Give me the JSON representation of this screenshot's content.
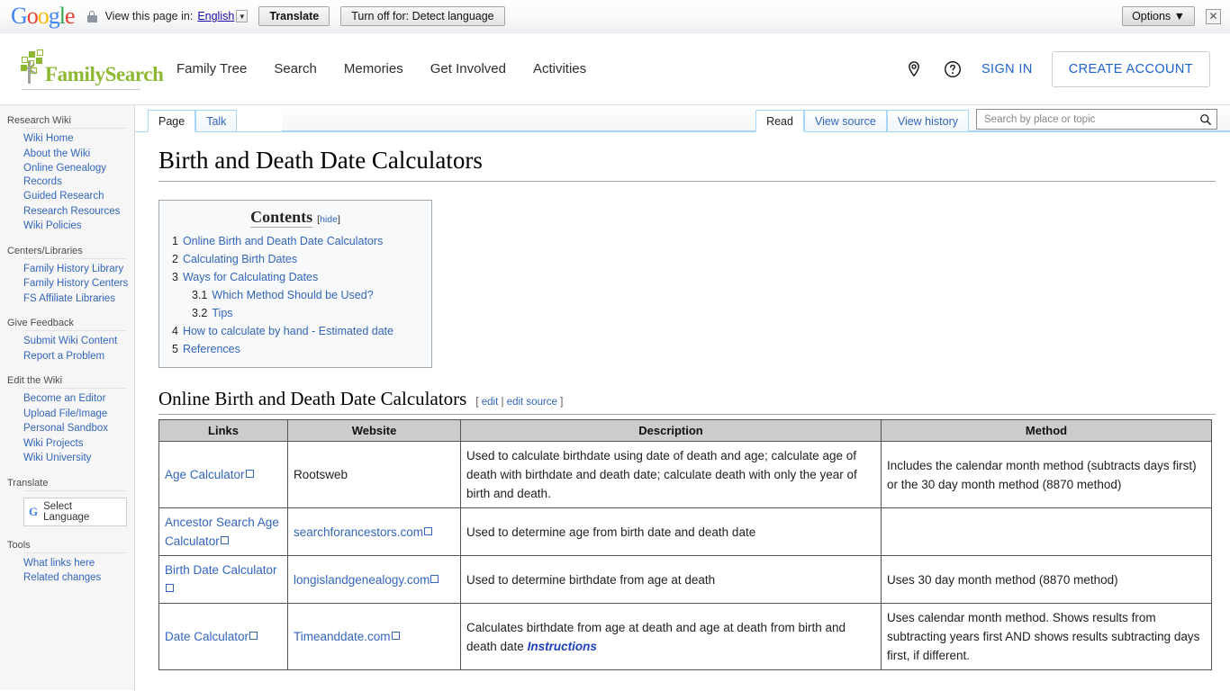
{
  "translate_bar": {
    "logo": "Google",
    "lock_icon": "lock-icon",
    "prompt": "View this page in:",
    "language": "English",
    "caret_icon": "chevron-down-icon",
    "translate_button": "Translate",
    "turn_off_button": "Turn off for: Detect language",
    "options_button": "Options ▼",
    "close_icon": "✕"
  },
  "site_header": {
    "brand": "FamilySearch",
    "nav": [
      {
        "label": "Family Tree"
      },
      {
        "label": "Search"
      },
      {
        "label": "Memories"
      },
      {
        "label": "Get Involved"
      },
      {
        "label": "Activities"
      }
    ],
    "location_icon": "location-pin-icon",
    "help_icon": "question-circle-icon",
    "sign_in": "SIGN IN",
    "create_account": "CREATE ACCOUNT"
  },
  "sidebar": {
    "groups": [
      {
        "heading": "Research Wiki",
        "items": [
          {
            "label": "Wiki Home"
          },
          {
            "label": "About the Wiki"
          },
          {
            "label": "Online Genealogy Records"
          },
          {
            "label": "Guided Research"
          },
          {
            "label": "Research Resources"
          },
          {
            "label": "Wiki Policies"
          }
        ]
      },
      {
        "heading": "Centers/Libraries",
        "items": [
          {
            "label": "Family History Library"
          },
          {
            "label": "Family History Centers"
          },
          {
            "label": "FS Affiliate Libraries"
          }
        ]
      },
      {
        "heading": "Give Feedback",
        "items": [
          {
            "label": "Submit Wiki Content"
          },
          {
            "label": "Report a Problem"
          }
        ]
      },
      {
        "heading": "Edit the Wiki",
        "items": [
          {
            "label": "Become an Editor"
          },
          {
            "label": "Upload File/Image"
          },
          {
            "label": "Personal Sandbox"
          },
          {
            "label": "Wiki Projects"
          },
          {
            "label": "Wiki University"
          }
        ]
      }
    ],
    "translate_heading": "Translate",
    "select_language": "Select Language",
    "tools_heading": "Tools",
    "tools_items": [
      {
        "label": "What links here"
      },
      {
        "label": "Related changes"
      }
    ]
  },
  "page_tabs": {
    "left": [
      {
        "label": "Page",
        "active": true
      },
      {
        "label": "Talk",
        "active": false
      }
    ],
    "right": [
      {
        "label": "Read",
        "active": true
      },
      {
        "label": "View source",
        "active": false
      },
      {
        "label": "View history",
        "active": false
      }
    ],
    "search_placeholder": "Search by place or topic",
    "search_value": "",
    "search_icon": "search-icon"
  },
  "article": {
    "title": "Birth and Death Date Calculators",
    "toc": {
      "heading": "Contents",
      "hide_open": "[",
      "hide_label": "hide",
      "hide_close": "]",
      "entries": [
        {
          "num": "1",
          "label": "Online Birth and Death Date Calculators",
          "level": 1
        },
        {
          "num": "2",
          "label": "Calculating Birth Dates",
          "level": 1
        },
        {
          "num": "3",
          "label": "Ways for Calculating Dates",
          "level": 1
        },
        {
          "num": "3.1",
          "label": "Which Method Should be Used?",
          "level": 2
        },
        {
          "num": "3.2",
          "label": "Tips",
          "level": 2
        },
        {
          "num": "4",
          "label": "How to calculate by hand - Estimated date",
          "level": 1
        },
        {
          "num": "5",
          "label": "References",
          "level": 1
        }
      ]
    },
    "section": {
      "heading": "Online Birth and Death Date Calculators",
      "edit_open": "[",
      "edit": "edit",
      "edit_sep": "|",
      "edit_source": "edit source",
      "edit_close": "]"
    },
    "table": {
      "headers": [
        "Links",
        "Website",
        "Description",
        "Method"
      ],
      "rows": [
        {
          "link": "Age Calculator",
          "link_external": true,
          "website": "Rootsweb",
          "website_external": false,
          "description": "Used to calculate birthdate using date of death and age; calculate age of death with birthdate and death date; calculate death with only the year of birth and death.",
          "method": "Includes the calendar month method (subtracts days first) or the 30 day month method (8870 method)"
        },
        {
          "link": "Ancestor Search Age Calculator",
          "link_external": true,
          "website": "searchforancestors.com",
          "website_external": true,
          "description": "Used to determine age from birth date and death date",
          "method": ""
        },
        {
          "link": "Birth Date Calculator",
          "link_external": true,
          "website": "longislandgenealogy.com",
          "website_external": true,
          "description": "Used to determine birthdate from age at death",
          "method": "Uses 30 day month method (8870 method)"
        },
        {
          "link": "Date Calculator",
          "link_external": true,
          "website": "Timeanddate.com",
          "website_external": true,
          "description": "Calculates birthdate from age at death and age at death from birth and death date",
          "description_emph": "Instructions",
          "method": "Uses calendar month method. Shows results from subtracting years first AND shows results subtracting days first, if different."
        }
      ]
    }
  }
}
